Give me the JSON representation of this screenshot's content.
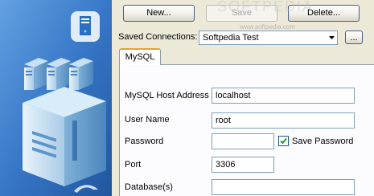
{
  "buttons": {
    "new": "New...",
    "save": "Save",
    "delete": "Delete...",
    "browse": "..."
  },
  "saved_connections": {
    "label": "Saved Connections:",
    "value": "Softpedia Test"
  },
  "tab": {
    "label": "MySQL"
  },
  "form": {
    "host_label": "MySQL Host Address",
    "host_value": "localhost",
    "user_label": "User Name",
    "user_value": "root",
    "password_label": "Password",
    "password_value": "",
    "save_password_label": "Save Password",
    "save_password_checked": true,
    "port_label": "Port",
    "port_value": "3306",
    "database_label": "Database(s)",
    "database_value": ""
  },
  "watermark": {
    "logo": "SOFTPEDIA",
    "url": "www.softpedia.com"
  },
  "icons": [
    "server-icon",
    "server-stack-icon",
    "dolphin-logo-icon",
    "dropdown-arrow-icon",
    "checkmark-icon"
  ],
  "colors": {
    "sidebar_blue": "#1f5fa8",
    "tab_accent": "#e6a03c",
    "field_border": "#7f9db9"
  }
}
